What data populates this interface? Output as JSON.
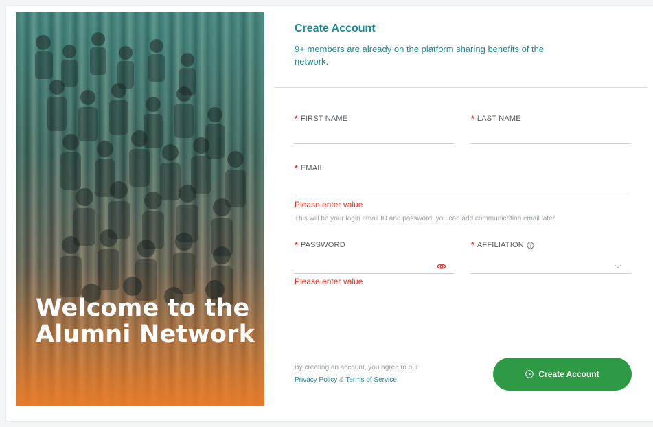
{
  "hero": {
    "image": "group-photo-alumni",
    "title": "Welcome to the Alumni Network"
  },
  "form": {
    "title": "Create Account",
    "subtitle": "9+ members are already on the platform sharing benefits of the network.",
    "required_mark": "*",
    "fields": {
      "first_name": {
        "label": "FIRST NAME",
        "value": ""
      },
      "last_name": {
        "label": "LAST NAME",
        "value": ""
      },
      "email": {
        "label": "EMAIL",
        "value": "",
        "error": "Please enter value",
        "hint": "This will be your login email ID and password, you can add communication email later."
      },
      "password": {
        "label": "PASSWORD",
        "value": "",
        "error": "Please enter value",
        "toggle_icon": "eye-icon"
      },
      "affiliation": {
        "label": "AFFILIATION",
        "selected": "",
        "help_icon": "question-circle-icon",
        "dropdown_icon": "chevron-down-icon"
      }
    },
    "legal": {
      "prefix": "By creating an account, you agree to our",
      "privacy_label": "Privacy Policy",
      "amp": "&",
      "terms_label": "Terms of Service",
      "suffix": "."
    },
    "submit": {
      "label": "Create Account",
      "icon": "chevron-right-circle-icon"
    }
  },
  "colors": {
    "accent": "#1d8b94",
    "button": "#2e9a45",
    "error": "#d9382e",
    "hero_gradient_bottom": "#ee7d28"
  }
}
